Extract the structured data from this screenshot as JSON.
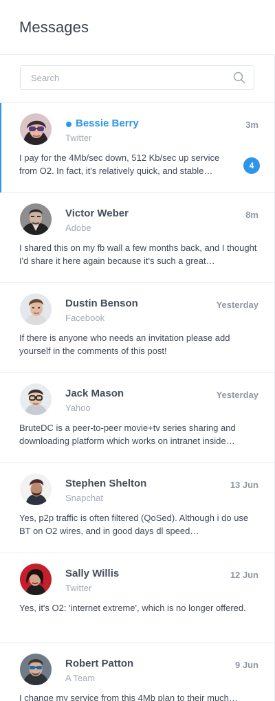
{
  "header": {
    "title": "Messages"
  },
  "search": {
    "placeholder": "Search",
    "value": ""
  },
  "colors": {
    "accent": "#2d96ea",
    "divider": "#e9ebef",
    "muted": "#a3aab5"
  },
  "messages": [
    {
      "name": "Bessie Berry",
      "source": "Twitter",
      "time": "3m",
      "preview": "I pay for the 4Mb/sec down, 512 Kb/sec up service from O2. In fact, it's relatively quick, and stable…",
      "unread": "4",
      "online": true,
      "active": true
    },
    {
      "name": "Victor Weber",
      "source": "Adobe",
      "time": "8m",
      "preview": "I shared this on my fb wall a few months back, and I thought I'd share it here again because it's such a great…"
    },
    {
      "name": "Dustin Benson",
      "source": "Facebook",
      "time": "Yesterday",
      "preview": "If there is anyone who needs an invitation please add yourself in the comments of this post!"
    },
    {
      "name": "Jack Mason",
      "source": "Yahoo",
      "time": "Yesterday",
      "preview": "BruteDC is a peer-to-peer movie+tv series sharing and downloading platform which works on intranet inside…"
    },
    {
      "name": "Stephen Shelton",
      "source": "Snapchat",
      "time": "13 Jun",
      "preview": "Yes, p2p traffic is often filtered (QoSed). Although i do use BT on O2 wires, and in good days dl speed…"
    },
    {
      "name": "Sally Willis",
      "source": "Twitter",
      "time": "12 Jun",
      "preview": "Yes, it's O2: 'internet extreme', which is no longer offered."
    },
    {
      "name": "Robert Patton",
      "source": "A Team",
      "time": "9 Jun",
      "preview": "I change my service from this 4Mb plan to their much…"
    }
  ]
}
